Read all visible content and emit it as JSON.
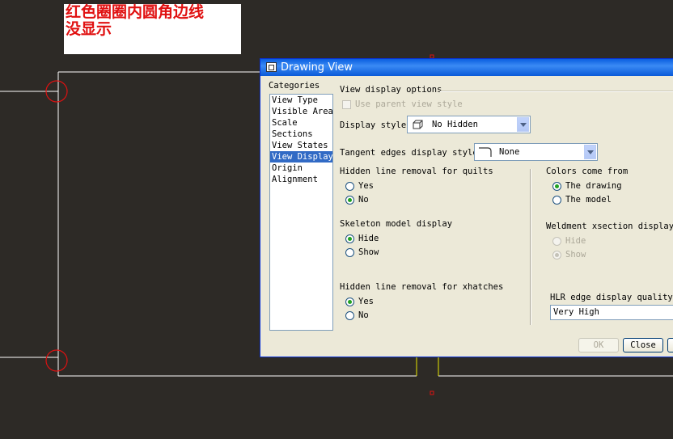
{
  "note": {
    "line1": "红色圈圈内圆角边线",
    "line2": "没显示"
  },
  "dialog": {
    "title": "Drawing View",
    "categories_label": "Categories",
    "categories": [
      "View Type",
      "Visible Area",
      "Scale",
      "Sections",
      "View States",
      "View Display",
      "Origin",
      "Alignment"
    ],
    "selected_category": "View Display",
    "view_display_options": "View display options",
    "use_parent_view_style": "Use parent view style",
    "display_style": {
      "label": "Display style",
      "value": "No Hidden"
    },
    "tangent_edges": {
      "label": "Tangent edges display style",
      "value": "None"
    },
    "hidden_line_quilts": {
      "label": "Hidden line removal for quilts",
      "yes": "Yes",
      "no": "No",
      "selected": "No"
    },
    "skeleton": {
      "label": "Skeleton model display",
      "hide": "Hide",
      "show": "Show",
      "selected": "Hide"
    },
    "hidden_line_xhatches": {
      "label": "Hidden line removal for xhatches",
      "yes": "Yes",
      "no": "No",
      "selected": "Yes"
    },
    "colors": {
      "label": "Colors come from",
      "drawing": "The drawing",
      "model": "The model",
      "selected": "The drawing"
    },
    "weldment": {
      "label": "Weldment xsection display",
      "hide": "Hide",
      "show": "Show",
      "selected": "Show"
    },
    "hlr_quality": {
      "label": "HLR edge display quality",
      "value": "Very High"
    },
    "buttons": {
      "ok": "OK",
      "close": "Close"
    }
  },
  "colors": {
    "background": "#2d2a26",
    "annotation": "#e01010",
    "selection": "#316ac5",
    "titlebar": "#0a5ee0"
  }
}
